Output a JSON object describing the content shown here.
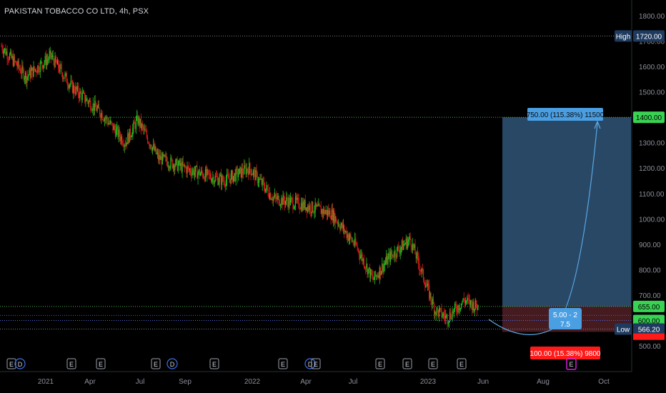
{
  "header": {
    "title": "PAKISTAN TOBACCO CO LTD, 4h, PSX"
  },
  "colors": {
    "background": "#000000",
    "up": "#26a69a",
    "candle_up": "#22c21f",
    "candle_down": "#d81b1b",
    "level_line": "#4caf50",
    "low_line": "#4f6bd8",
    "target_zone": "#2b4c6b",
    "stop_zone": "#4a1c22",
    "tag_blue": "#4a9fe3",
    "tag_red": "#ff1a1a",
    "tag_green": "#39d353",
    "tag_navy": "#1e3a5f"
  },
  "chart_data": {
    "type": "candlestick",
    "x_axis_labels": [
      "2021",
      "Apr",
      "Jul",
      "Sep",
      "2022",
      "Apr",
      "Jul",
      "2023",
      "Jun",
      "Aug",
      "Oct"
    ],
    "y_ticks": [
      500,
      600,
      700,
      800,
      900,
      1000,
      1100,
      1200,
      1300,
      1400,
      1500,
      1600,
      1700,
      1800
    ],
    "ylim": [
      470,
      1840
    ],
    "price_trend": [
      {
        "i": 0,
        "v": 1680
      },
      {
        "i": 30,
        "v": 1560
      },
      {
        "i": 60,
        "v": 1640
      },
      {
        "i": 85,
        "v": 1520
      },
      {
        "i": 120,
        "v": 1420
      },
      {
        "i": 150,
        "v": 1300
      },
      {
        "i": 165,
        "v": 1390
      },
      {
        "i": 190,
        "v": 1240
      },
      {
        "i": 230,
        "v": 1190
      },
      {
        "i": 270,
        "v": 1150
      },
      {
        "i": 300,
        "v": 1200
      },
      {
        "i": 330,
        "v": 1080
      },
      {
        "i": 360,
        "v": 1060
      },
      {
        "i": 400,
        "v": 1020
      },
      {
        "i": 430,
        "v": 890
      },
      {
        "i": 450,
        "v": 760
      },
      {
        "i": 470,
        "v": 850
      },
      {
        "i": 495,
        "v": 920
      },
      {
        "i": 510,
        "v": 780
      },
      {
        "i": 525,
        "v": 640
      },
      {
        "i": 540,
        "v": 610
      },
      {
        "i": 560,
        "v": 680
      },
      {
        "i": 575,
        "v": 655
      }
    ],
    "levels": [
      {
        "name": "High",
        "value": 1720.0,
        "label": "1720.00",
        "tag": "High"
      },
      {
        "name": "target",
        "value": 1400.0,
        "label": "1400.00"
      },
      {
        "name": "entry",
        "value": 655.0,
        "label": "655.00"
      },
      {
        "name": "mid",
        "value": 600.0,
        "label": "600.00"
      },
      {
        "name": "Low",
        "value": 566.2,
        "label": "566.20",
        "tag": "Low"
      }
    ],
    "target_annotation": "750.00 (115.38%) 11500",
    "stop_annotation": "100.00 (15.38%) 9800",
    "ratio_annotation": {
      "line1": "5.00 - 2",
      "line2": "7.5"
    },
    "event_markers": [
      "E",
      "D",
      "E",
      "E",
      "E",
      "D",
      "E",
      "E",
      "D",
      "E",
      "E",
      "E",
      "E"
    ]
  }
}
